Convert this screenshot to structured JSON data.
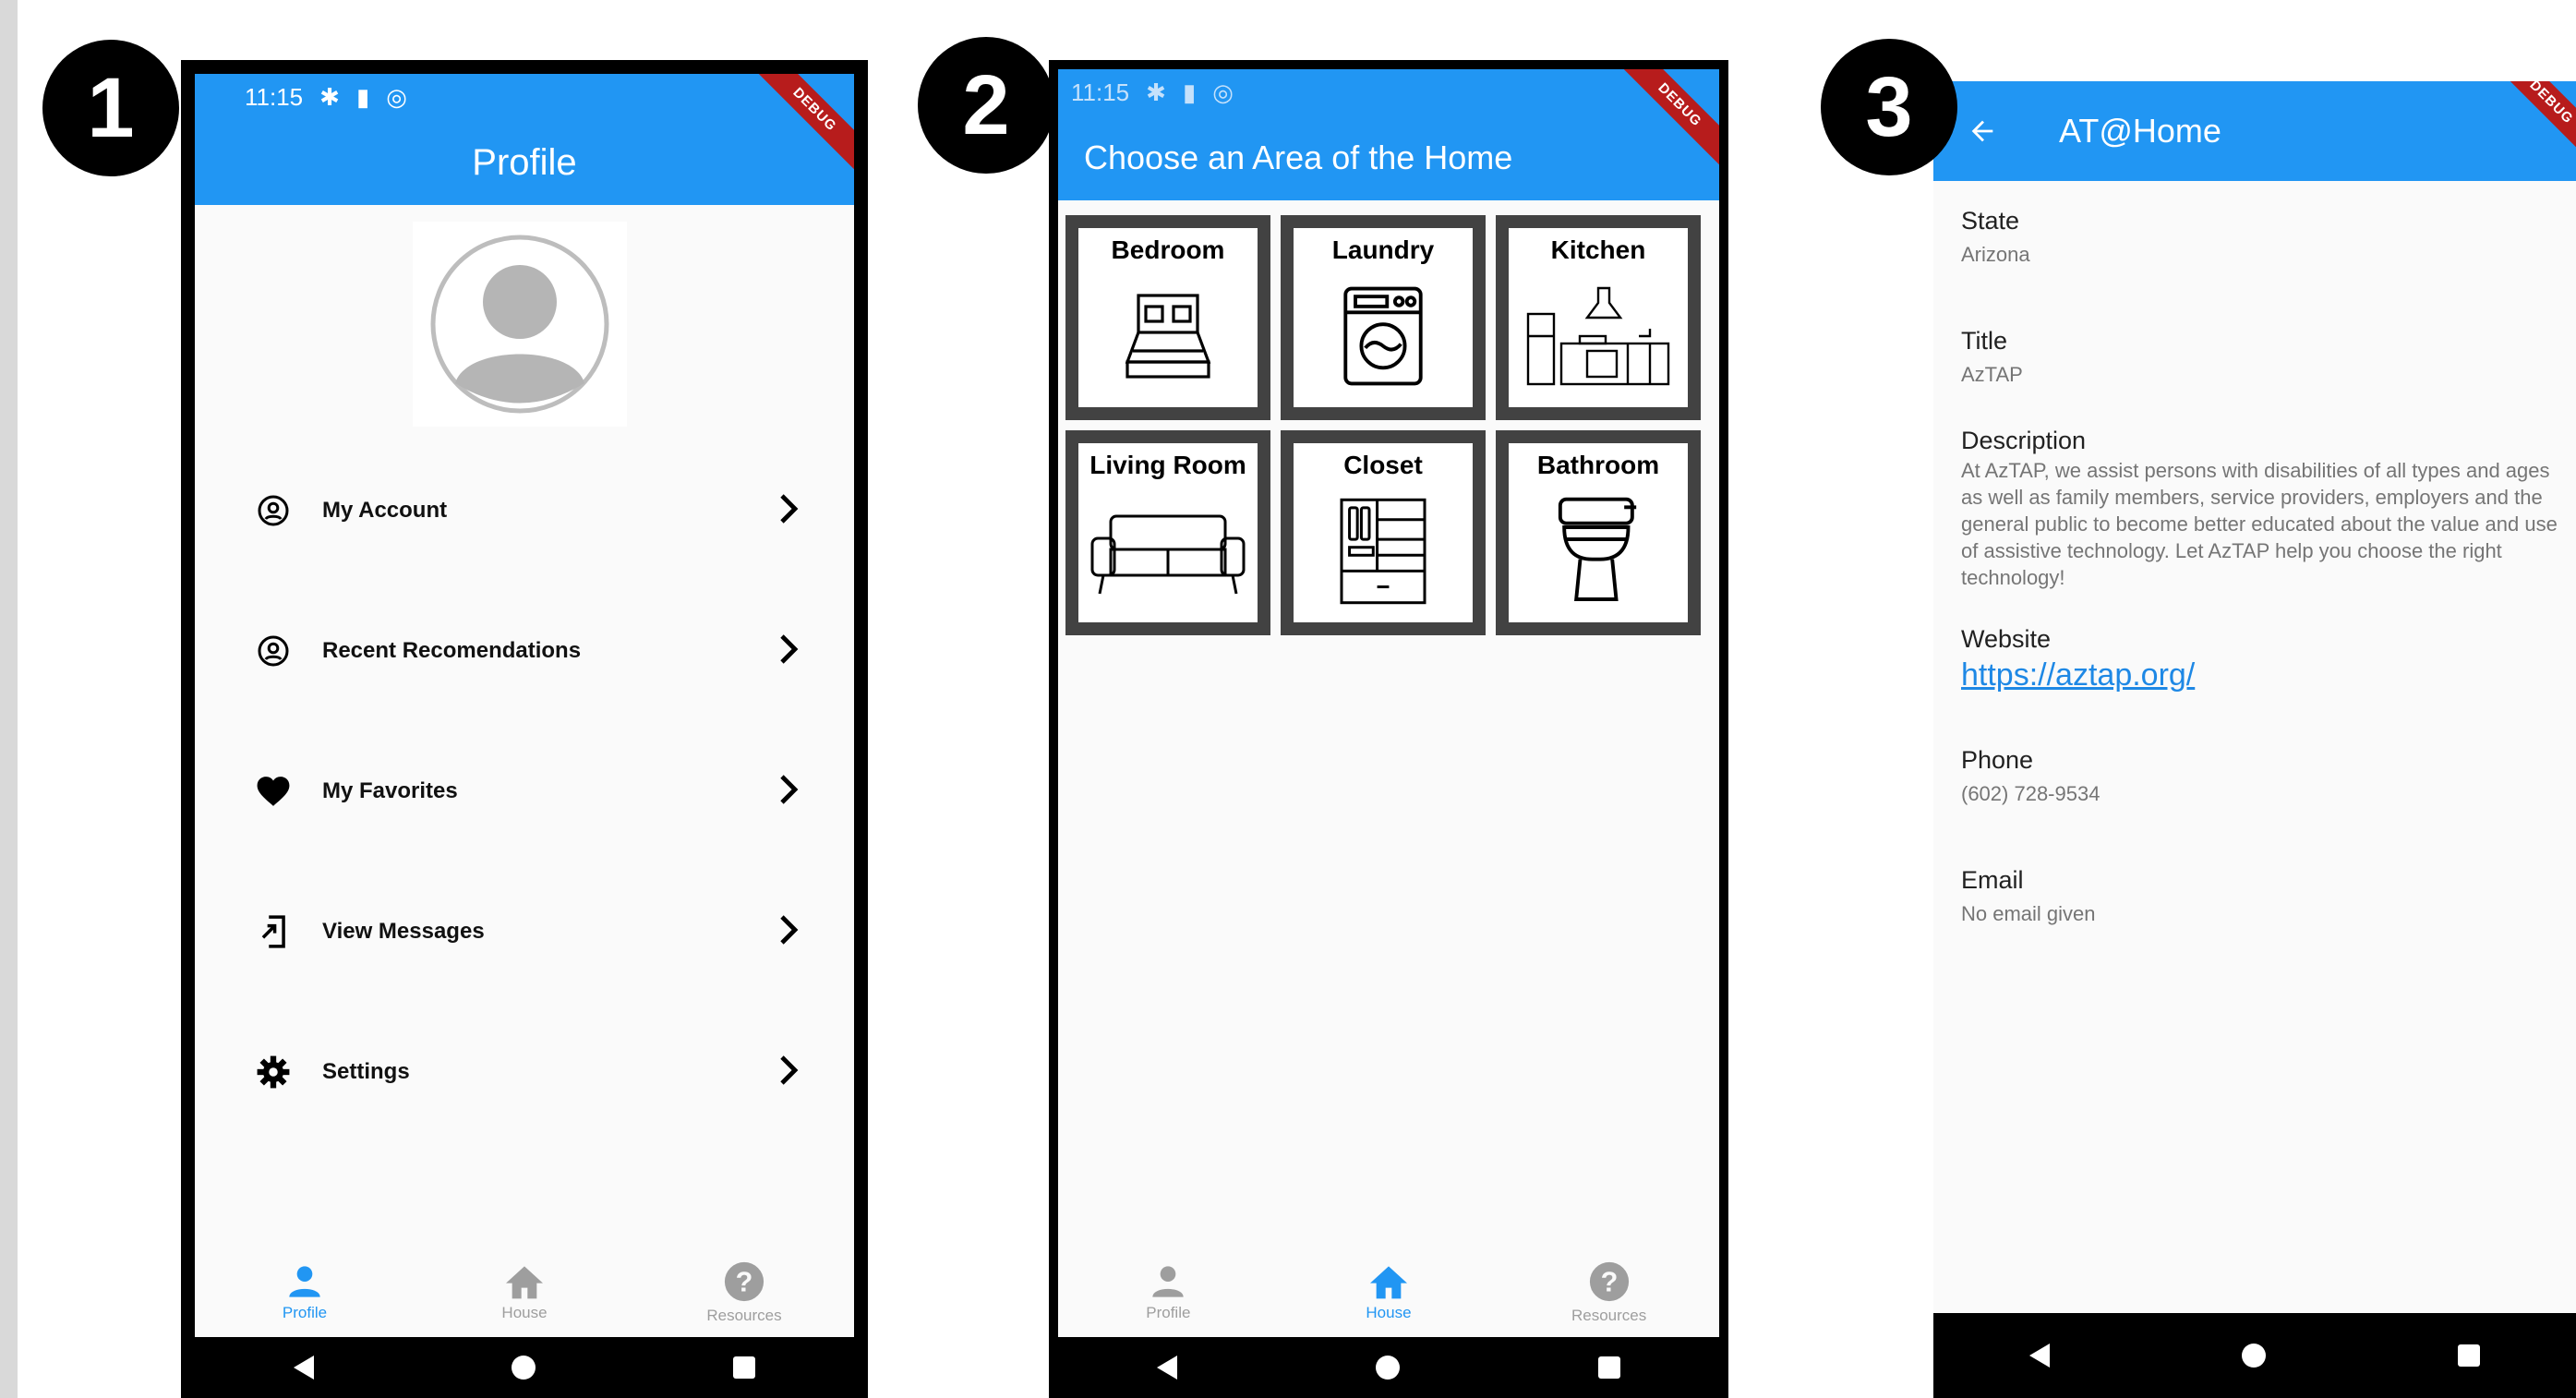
{
  "badges": [
    "1",
    "2",
    "3"
  ],
  "status": {
    "time": "11:15"
  },
  "debug_label": "DEBUG",
  "profile_screen": {
    "title": "Profile",
    "menu": [
      {
        "label": "My Account",
        "icon": "account-circle-icon"
      },
      {
        "label": "Recent Recomendations",
        "icon": "account-circle-icon"
      },
      {
        "label": "My Favorites",
        "icon": "heart-icon"
      },
      {
        "label": "View Messages",
        "icon": "open-in-icon"
      },
      {
        "label": "Settings",
        "icon": "gear-icon"
      }
    ],
    "active_tab": "Profile"
  },
  "house_screen": {
    "title": "Choose an Area of the Home",
    "rooms": [
      "Bedroom",
      "Laundry",
      "Kitchen",
      "Living Room",
      "Closet",
      "Bathroom"
    ],
    "active_tab": "House"
  },
  "tabs": [
    "Profile",
    "House",
    "Resources"
  ],
  "detail_screen": {
    "title": "AT@Home",
    "fields": [
      {
        "label": "State",
        "value": "Arizona"
      },
      {
        "label": "Title",
        "value": "AzTAP"
      },
      {
        "label": "Description",
        "value": "At AzTAP, we assist persons with disabilities of all types and ages as well as family members, service providers, employers and the general public to become better educated about the value and use of assistive technology. Let AzTAP help you choose the right technology!"
      },
      {
        "label": "Website",
        "value": "https://aztap.org/"
      },
      {
        "label": "Phone",
        "value": "(602) 728-9534"
      },
      {
        "label": "Email",
        "value": "No email given"
      }
    ]
  },
  "colors": {
    "primary": "#2196f3",
    "tile_border": "#424242",
    "debug": "#b71c1c"
  }
}
